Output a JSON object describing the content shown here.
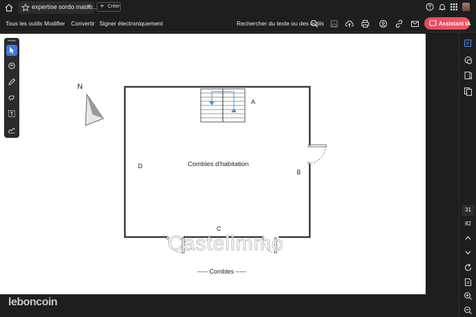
{
  "tab": {
    "title": "expertise sordo maiso...",
    "close": "×"
  },
  "create": {
    "plus": "+",
    "label": "Créer"
  },
  "menu": {
    "all_tools": "Tous les outils",
    "edit": "Modifier",
    "convert": "Convertir",
    "sign": "Signer électroniquement"
  },
  "search": {
    "label": "Rechercher du texte ou des outils"
  },
  "ai": {
    "label": "Assistant IA"
  },
  "plan": {
    "north": "N",
    "label_a": "A",
    "label_b": "B",
    "label_c": "C",
    "label_d": "D",
    "room": "Combles d'habitation",
    "footer": "----- Combles -----",
    "watermark": "Castelimmo"
  },
  "pagination": {
    "current": "31",
    "total": "82"
  },
  "site_watermark": "leboncoin",
  "colors": {
    "accent": "#3b7ae0",
    "ai_button": "#ee4f63",
    "stair_arrow": "#4a90e2"
  }
}
